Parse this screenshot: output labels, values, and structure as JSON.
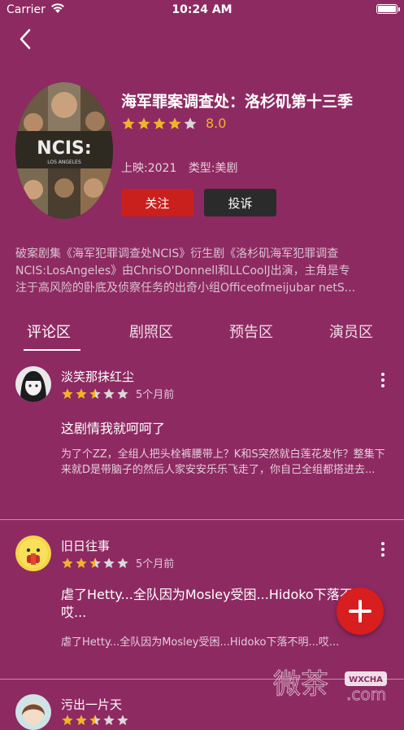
{
  "status_bar": {
    "carrier": "Carrier",
    "time": "10:24 AM"
  },
  "show": {
    "title": "海军罪案调查处：洛杉矶第十三季",
    "poster_text": "NCIS:",
    "poster_subtext": "LOS ANGELES",
    "rating": "8.0",
    "rating_stars": 4,
    "release": "上映:2021",
    "genre": "类型:美剧",
    "follow_label": "关注",
    "report_label": "投诉",
    "description_lines": [
      "破案剧集《海军犯罪调查处NCIS》衍生剧《洛杉矶海军犯罪调查",
      "NCIS:LosAngeles》由ChrisO'Donnell和LLCoolJ出演，主角是专",
      "注于高风险的卧底及侦察任务的出奇小组Officeofmeijubar netS..."
    ]
  },
  "tabs": [
    "评论区",
    "剧照区",
    "预告区",
    "演员区"
  ],
  "comments": [
    {
      "user": "淡笑那抹红尘",
      "stars": 2.5,
      "time": "5个月前",
      "title": "这剧情我就呵呵了",
      "body": "为了个ZZ，全组人把头栓裤腰带上？K和S突然就白莲花发作？整集下来就D是带脑子的然后人家安安乐乐飞走了，你自己全组都搭进去..."
    },
    {
      "user": "旧日往事",
      "stars": 2.5,
      "time": "5个月前",
      "title": "虐了Hetty...全队因为Mosley受困...Hidoko下落不明...哎...",
      "body": "虐了Hetty...全队因为Mosley受困...Hidoko下落不明...哎..."
    },
    {
      "user": "污出一片天",
      "stars": 2.5,
      "time": "",
      "title": "",
      "body": ""
    }
  ],
  "watermark": {
    "text": "微茶",
    "badge": "WXCHA",
    "domain": ".com"
  },
  "colors": {
    "background": "#8e2a62",
    "accent_red": "#c9201e",
    "star": "#f0b429"
  }
}
